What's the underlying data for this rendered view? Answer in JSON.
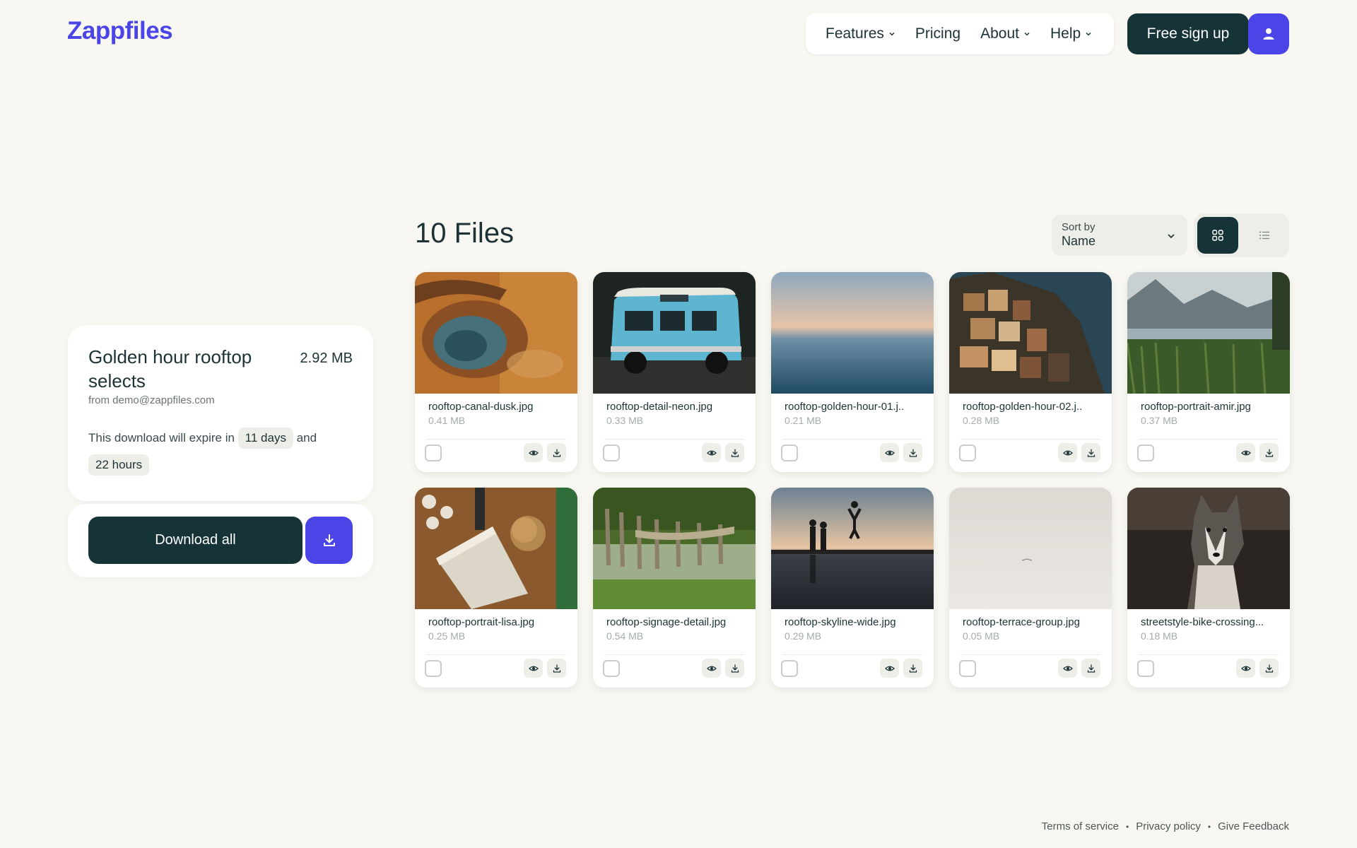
{
  "brand": {
    "name": "Zappfiles",
    "accent": "#4b44e6",
    "dark": "#163437"
  },
  "nav": {
    "items": [
      {
        "label": "Features",
        "has_dropdown": true
      },
      {
        "label": "Pricing",
        "has_dropdown": false
      },
      {
        "label": "About",
        "has_dropdown": true
      },
      {
        "label": "Help",
        "has_dropdown": true
      }
    ],
    "signup_label": "Free sign up",
    "user_icon": "user-icon"
  },
  "transfer": {
    "title": "Golden hour rooftop selects",
    "size": "2.92 MB",
    "from": "from demo@zappfiles.com",
    "expire_prefix": "This download will expire in",
    "days": "11 days",
    "joiner": "and",
    "hours": "22 hours",
    "download_all_label": "Download all"
  },
  "files_header": {
    "title": "10 Files",
    "sort_label": "Sort by",
    "sort_value": "Name",
    "view_mode": "grid"
  },
  "files": [
    {
      "name": "rooftop-canal-dusk.jpg",
      "size": "0.41 MB",
      "thumb": "crater"
    },
    {
      "name": "rooftop-detail-neon.jpg",
      "size": "0.33 MB",
      "thumb": "van"
    },
    {
      "name": "rooftop-golden-hour-01.j..",
      "size": "0.21 MB",
      "thumb": "sea"
    },
    {
      "name": "rooftop-golden-hour-02.j..",
      "size": "0.28 MB",
      "thumb": "cliff-town"
    },
    {
      "name": "rooftop-portrait-amir.jpg",
      "size": "0.37 MB",
      "thumb": "lake"
    },
    {
      "name": "rooftop-portrait-lisa.jpg",
      "size": "0.25 MB",
      "thumb": "desk"
    },
    {
      "name": "rooftop-signage-detail.jpg",
      "size": "0.54 MB",
      "thumb": "pier"
    },
    {
      "name": "rooftop-skyline-wide.jpg",
      "size": "0.29 MB",
      "thumb": "jump"
    },
    {
      "name": "rooftop-terrace-group.jpg",
      "size": "0.05 MB",
      "thumb": "fog"
    },
    {
      "name": "streetstyle-bike-crossing...",
      "size": "0.18 MB",
      "thumb": "husky"
    }
  ],
  "footer": {
    "links": [
      "Terms of service",
      "Privacy policy",
      "Give Feedback"
    ],
    "separator": "•"
  }
}
